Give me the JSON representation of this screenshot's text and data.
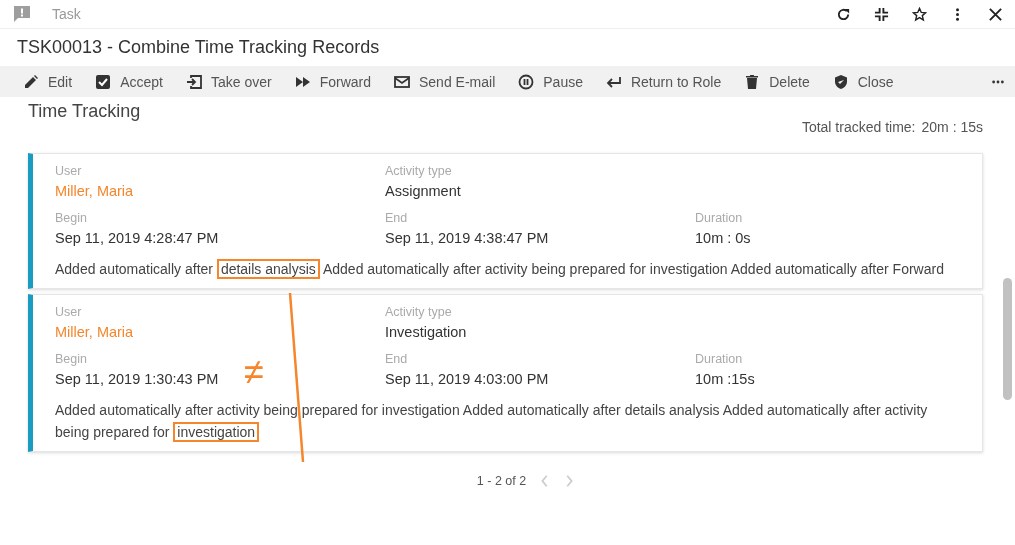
{
  "window": {
    "title": "Task"
  },
  "record_title": "TSK00013 - Combine Time Tracking Records",
  "toolbar": [
    {
      "label": "Edit",
      "kind": "edit"
    },
    {
      "label": "Accept",
      "kind": "accept"
    },
    {
      "label": "Take over",
      "kind": "takeover"
    },
    {
      "label": "Forward",
      "kind": "forward"
    },
    {
      "label": "Send E-mail",
      "kind": "mail"
    },
    {
      "label": "Pause",
      "kind": "pause"
    },
    {
      "label": "Return to Role",
      "kind": "return"
    },
    {
      "label": "Delete",
      "kind": "delete"
    },
    {
      "label": "Close",
      "kind": "close"
    }
  ],
  "section": {
    "title": "Time Tracking",
    "total_label": "Total tracked time:",
    "total_value": "20m : 15s"
  },
  "records": [
    {
      "rows": [
        [
          {
            "label": "User",
            "value": "Miller, Maria",
            "kind": "link"
          },
          {
            "label": "Activity type",
            "value": "Assignment",
            "kind": "text"
          }
        ],
        [
          {
            "label": "Begin",
            "value": "Sep 11, 2019 4:28:47 PM",
            "kind": "text"
          },
          {
            "label": "End",
            "value": "Sep 11, 2019 4:38:47 PM",
            "kind": "text"
          },
          {
            "label": "Duration",
            "value": "10m : 0s",
            "kind": "text"
          }
        ]
      ],
      "note": [
        {
          "text": "Added automatically after ",
          "highlighted": false
        },
        {
          "text": "details analysis",
          "highlighted": true
        },
        {
          "text": " Added automatically after activity being prepared for investigation Added automatically after Forward",
          "highlighted": false
        }
      ]
    },
    {
      "rows": [
        [
          {
            "label": "User",
            "value": "Miller, Maria",
            "kind": "link"
          },
          {
            "label": "Activity type",
            "value": "Investigation",
            "kind": "text"
          }
        ],
        [
          {
            "label": "Begin",
            "value": "Sep 11, 2019 1:30:43 PM",
            "kind": "text"
          },
          {
            "label": "End",
            "value": "Sep 11, 2019 4:03:00 PM",
            "kind": "text"
          },
          {
            "label": "Duration",
            "value": "10m :15s",
            "kind": "text"
          }
        ]
      ],
      "note": [
        {
          "text": "Added automatically after activity being prepared for investigation Added automatically after details analysis Added automatically after activity being prepared for ",
          "highlighted": false
        },
        {
          "text": "investigation",
          "highlighted": true
        }
      ]
    }
  ],
  "annotation": {
    "mark": "≠"
  },
  "pagination": {
    "range": "1 - 2 of 2"
  }
}
